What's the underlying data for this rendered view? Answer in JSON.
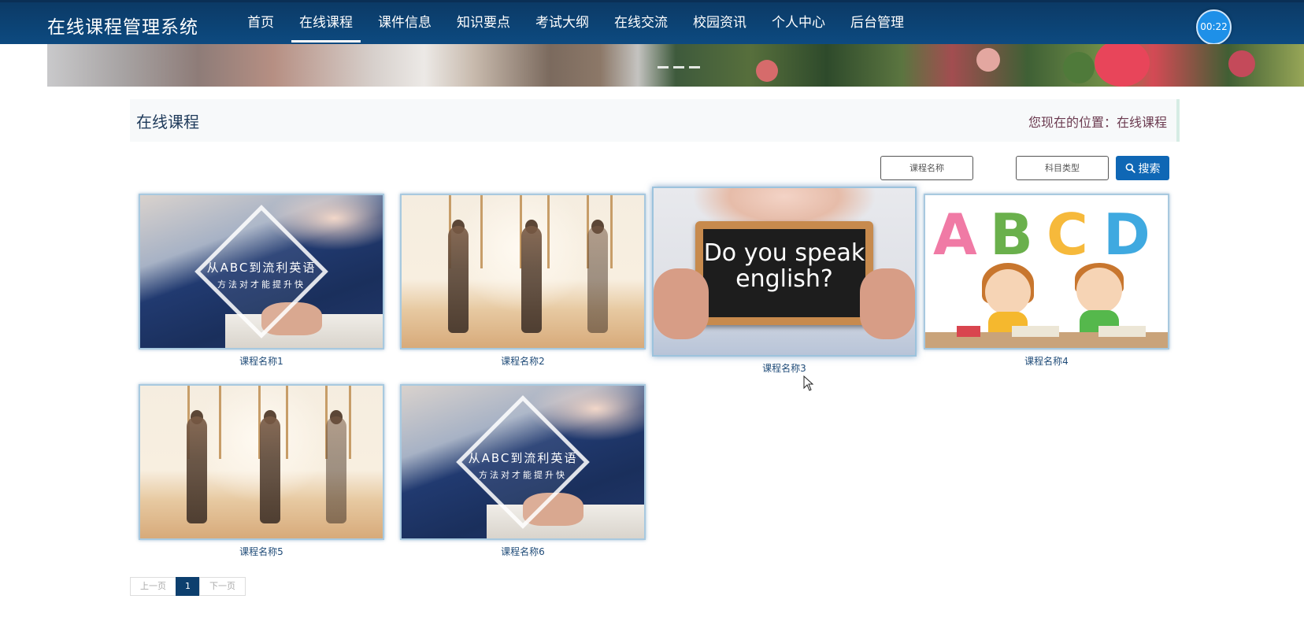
{
  "header": {
    "brand": "在线课程管理系统",
    "nav": [
      {
        "label": "首页",
        "active": false
      },
      {
        "label": "在线课程",
        "active": true
      },
      {
        "label": "课件信息",
        "active": false
      },
      {
        "label": "知识要点",
        "active": false
      },
      {
        "label": "考试大纲",
        "active": false
      },
      {
        "label": "在线交流",
        "active": false
      },
      {
        "label": "校园资讯",
        "active": false
      },
      {
        "label": "个人中心",
        "active": false
      },
      {
        "label": "后台管理",
        "active": false
      }
    ],
    "timer": "00:22"
  },
  "title_bar": {
    "title": "在线课程",
    "location": "您现在的位置：在线课程"
  },
  "search": {
    "course_name_placeholder": "课程名称",
    "subject_type_placeholder": "科目类型",
    "button_label": "搜索"
  },
  "courses": [
    {
      "name": "课程名称1",
      "image": "student-english",
      "overlay_line1": "从ABC到流利英语",
      "overlay_line2": "方法对才能提升快"
    },
    {
      "name": "课程名称2",
      "image": "aerial-yoga"
    },
    {
      "name": "课程名称3",
      "image": "do-you-speak-english",
      "board_text": "Do you speak english?"
    },
    {
      "name": "课程名称4",
      "image": "abc-kids",
      "letters": [
        "A",
        "B",
        "C",
        "D"
      ]
    },
    {
      "name": "课程名称5",
      "image": "aerial-yoga"
    },
    {
      "name": "课程名称6",
      "image": "student-english",
      "overlay_line1": "从ABC到流利英语",
      "overlay_line2": "方法对才能提升快"
    }
  ],
  "pagination": {
    "prev": "上一页",
    "current": "1",
    "next": "下一页"
  },
  "colors": {
    "header_bg": "#0d4a80",
    "accent": "#0f67b5",
    "caption": "#1f4b78",
    "location_text": "#6b3b50"
  }
}
